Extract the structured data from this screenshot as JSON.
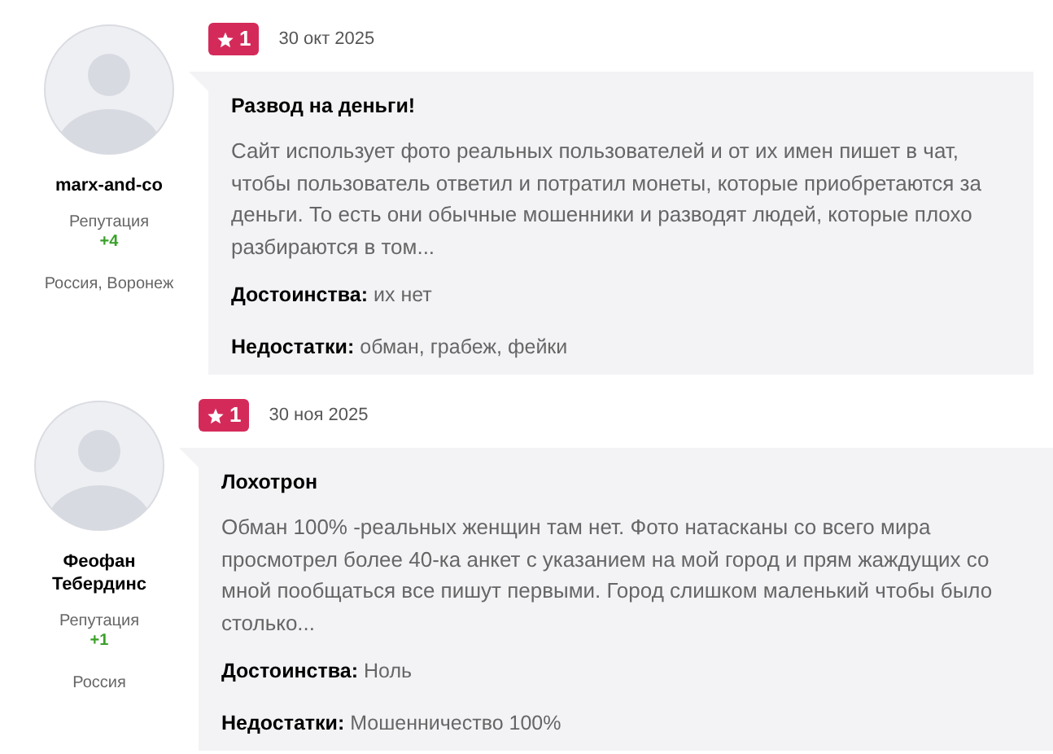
{
  "reviews": [
    {
      "author": "marx-and-co",
      "reputation_label": "Репутация",
      "reputation": "+4",
      "location": "Россия, Воронеж",
      "rating": "1",
      "date": "30 окт 2025",
      "title": "Развод на деньги!",
      "text": "Сайт использует фото реальных пользователей и от их имен пишет в чат, чтобы пользователь ответил и потратил монеты, которые приобретаются за деньги. То есть они обычные мошенники и разводят людей, которые плохо разбираются в том...",
      "pros_label": "Достоинства:",
      "pros": "их нет",
      "cons_label": "Недостатки:",
      "cons": "обман, грабеж, фейки"
    },
    {
      "author": "Феофан Тебердинс",
      "reputation_label": "Репутация",
      "reputation": "+1",
      "location": "Россия",
      "rating": "1",
      "date": "30 ноя 2025",
      "title": "Лохотрон",
      "text": "Обман 100% -реальных женщин там нет. Фото натасканы со всего мира просмотрел более 40-ка анкет с указанием на мой город и прям жаждущих со мной пообщаться все пишут первыми. Город слишком маленький чтобы было столько...",
      "pros_label": "Достоинства:",
      "pros": "Ноль",
      "cons_label": "Недостатки:",
      "cons": "Мошенничество 100%"
    }
  ]
}
